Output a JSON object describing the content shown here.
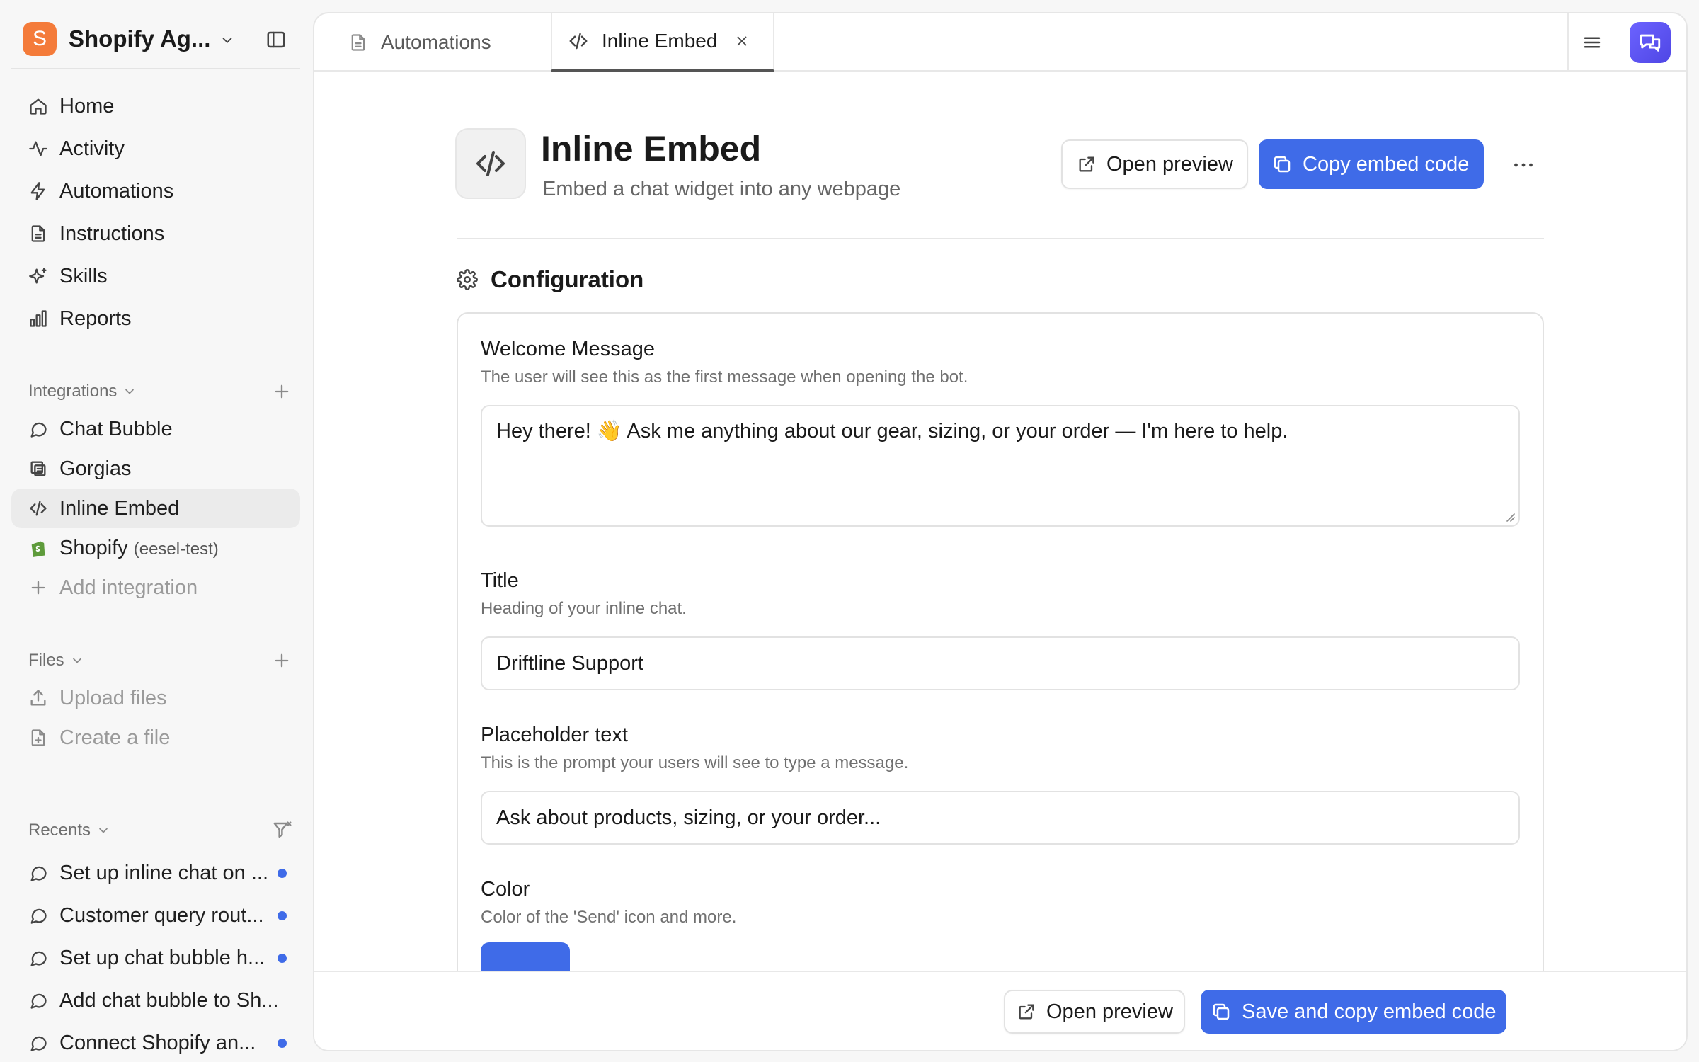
{
  "workspace": {
    "logo_letter": "S",
    "name": "Shopify Ag...",
    "logo_color": "#f47b3a"
  },
  "nav": [
    {
      "label": "Home",
      "icon": "home-icon"
    },
    {
      "label": "Activity",
      "icon": "activity-icon"
    },
    {
      "label": "Automations",
      "icon": "lightning-icon"
    },
    {
      "label": "Instructions",
      "icon": "document-icon"
    },
    {
      "label": "Skills",
      "icon": "sparkles-icon"
    },
    {
      "label": "Reports",
      "icon": "bar-chart-icon"
    }
  ],
  "integrations": {
    "header": "Integrations",
    "items": [
      {
        "label": "Chat Bubble",
        "icon": "chat-bubble-icon"
      },
      {
        "label": "Gorgias",
        "icon": "gorgias-icon"
      },
      {
        "label": "Inline Embed",
        "icon": "code-icon"
      },
      {
        "label": "Shopify",
        "sub": "(eesel-test)",
        "icon": "shopify-icon"
      }
    ],
    "add_label": "Add integration"
  },
  "files": {
    "header": "Files",
    "upload_label": "Upload files",
    "create_label": "Create a file"
  },
  "recents": {
    "header": "Recents",
    "items": [
      {
        "label": "Set up inline chat on ...",
        "unread": true
      },
      {
        "label": "Customer query rout...",
        "unread": true
      },
      {
        "label": "Set up chat bubble h...",
        "unread": true
      },
      {
        "label": "Add chat bubble to Sh...",
        "unread": false
      },
      {
        "label": "Connect Shopify an...",
        "unread": true
      }
    ]
  },
  "tabs": [
    {
      "label": "Automations",
      "icon": "document-icon",
      "active": false
    },
    {
      "label": "Inline Embed",
      "icon": "code-icon",
      "active": true
    }
  ],
  "page": {
    "title": "Inline Embed",
    "subtitle": "Embed a chat widget into any webpage",
    "open_preview_label": "Open preview",
    "copy_label": "Copy embed code"
  },
  "config": {
    "header": "Configuration",
    "welcome": {
      "label": "Welcome Message",
      "help": "The user will see this as the first message when opening the bot.",
      "value": "Hey there! 👋 Ask me anything about our gear, sizing, or your order — I'm here to help."
    },
    "title": {
      "label": "Title",
      "help": "Heading of your inline chat.",
      "value": "Driftline Support"
    },
    "placeholder": {
      "label": "Placeholder text",
      "help": "This is the prompt your users will see to type a message.",
      "value": "Ask about products, sizing, or your order..."
    },
    "color": {
      "label": "Color",
      "help": "Color of the 'Send' icon and more.",
      "value": "#3f6be8"
    }
  },
  "footer": {
    "open_preview_label": "Open preview",
    "save_label": "Save and copy embed code"
  },
  "colors": {
    "accent": "#3f6be8",
    "unread_dot": "#3f6be8",
    "chat_button": "#5b55f0"
  }
}
